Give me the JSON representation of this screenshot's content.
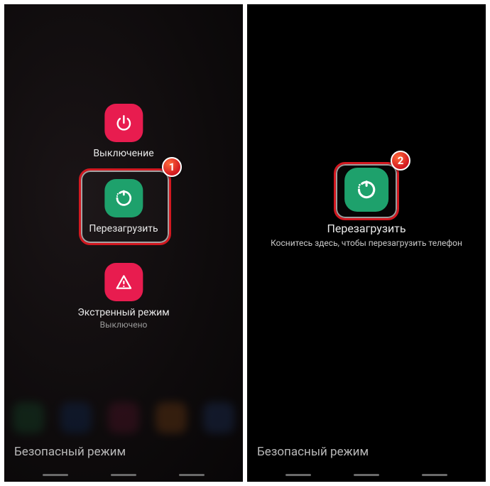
{
  "left": {
    "power_off": {
      "label": "Выключение"
    },
    "restart": {
      "label": "Перезагрузить"
    },
    "emergency": {
      "label": "Экстренный режим",
      "sublabel": "Выключено"
    },
    "safemode": "Безопасный режим",
    "badge": "1"
  },
  "right": {
    "restart": {
      "label": "Перезагрузить",
      "hint": "Коснитесь здесь, чтобы перезагрузить телефон"
    },
    "safemode": "Безопасный режим",
    "badge": "2"
  },
  "colors": {
    "accent_red": "#e81c4f",
    "accent_green": "#1aa06a",
    "badge": "#d21820"
  }
}
